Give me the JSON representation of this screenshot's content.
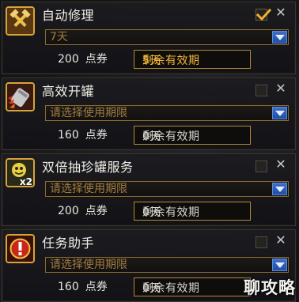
{
  "panels": [
    {
      "title": "自动修理",
      "icon": "hammer-icon",
      "checked": true,
      "select_value": "7天",
      "price_value": "200",
      "price_unit": "点券",
      "remaining_label": "剩余有效期",
      "remaining_value": "5天",
      "remaining_active": true
    },
    {
      "title": "高效开罐",
      "icon": "can-opener-icon",
      "checked": false,
      "select_value": "请选择使用期限",
      "price_value": "160",
      "price_unit": "点券",
      "remaining_label": "剩余有效期",
      "remaining_value": "0天",
      "remaining_active": false
    },
    {
      "title": "双倍抽珍罐服务",
      "icon": "double-draw-icon",
      "icon_badge": "x2",
      "checked": false,
      "select_value": "请选择使用期限",
      "price_value": "200",
      "price_unit": "点券",
      "remaining_label": "剩余有效期",
      "remaining_value": "0天",
      "remaining_active": false
    },
    {
      "title": "任务助手",
      "icon": "task-assistant-icon",
      "checked": false,
      "select_value": "请选择使用期限",
      "price_value": "160",
      "price_unit": "点券",
      "remaining_label": "剩余有效期",
      "remaining_value": "0天",
      "remaining_active": false
    }
  ],
  "watermark": "聊攻略",
  "colors": {
    "accent_gold": "#d7a43b",
    "remaining_active_text": "#f2b43a",
    "select_arrow_blue": "#2a5cb8",
    "check_gold": "#f0b232"
  }
}
